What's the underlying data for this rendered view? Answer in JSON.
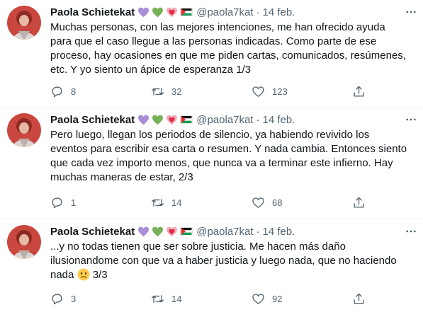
{
  "colors": {
    "text": "#0f1419",
    "secondary": "#536471",
    "divider": "#eff3f4"
  },
  "tweets": [
    {
      "author": {
        "name": "Paola Schietekat",
        "handle": "@paola7kat"
      },
      "date": "14 feb.",
      "text": "Muchas personas, con las mejores intenciones, me han ofrecido ayuda para que el caso llegue a las personas indicadas. Como parte de ese proceso, hay ocasiones en que me piden cartas, comunicados, resúmenes, etc. Y yo siento un ápice de esperanza 1/3",
      "replies": "8",
      "retweets": "32",
      "likes": "123"
    },
    {
      "author": {
        "name": "Paola Schietekat",
        "handle": "@paola7kat"
      },
      "date": "14 feb.",
      "text": "Pero luego, llegan los periodos de silencio, ya habiendo revivido los eventos para escribir esa carta o resumen. Y nada cambia. Entonces siento que cada vez importo menos, que nunca va a terminar este infierno. Hay muchas maneras de estar, 2/3",
      "replies": "1",
      "retweets": "14",
      "likes": "68"
    },
    {
      "author": {
        "name": "Paola Schietekat",
        "handle": "@paola7kat"
      },
      "date": "14 feb.",
      "text": "...y no todas tienen que ser sobre justicia. Me hacen más daño ilusionandome con que va a haber justicia y luego nada, que no haciendo nada",
      "text_suffix": " 3/3",
      "replies": "3",
      "retweets": "14",
      "likes": "92"
    }
  ],
  "icons": {
    "name_emojis": [
      "purple-heart-icon",
      "green-heart-icon",
      "sparkling-heart-icon",
      "palestine-flag-icon"
    ],
    "text_emoji": "sad-face-icon",
    "actions": [
      "reply-icon",
      "retweet-icon",
      "like-icon",
      "share-icon"
    ],
    "menu": "more-icon"
  }
}
